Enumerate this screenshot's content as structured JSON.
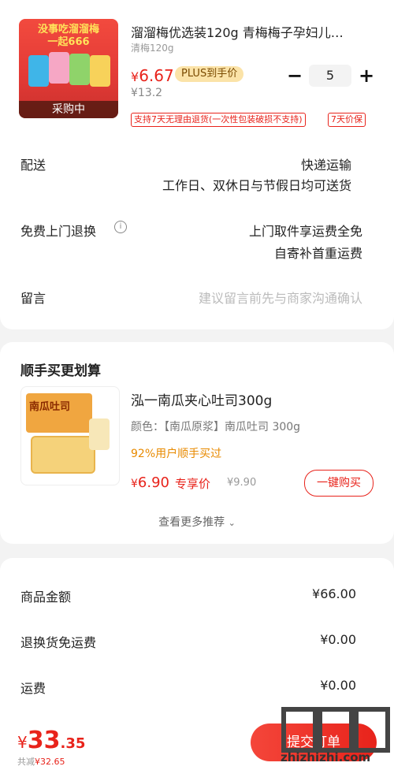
{
  "product": {
    "image": {
      "banner": "没事吃溜溜梅\n一起666",
      "status": "采购中"
    },
    "title": "溜溜梅优选装120g 青梅梅子孕妇儿…",
    "spec": "清梅120g",
    "price_symbol": "¥",
    "price": "6.67",
    "plus_badge": "PLUS到手价",
    "original_price": "¥13.2",
    "quantity": "5",
    "minus_icon": "minus-icon",
    "plus_icon": "plus-icon",
    "tags": [
      "支持7天无理由退货(一次性包装破损不支持)",
      "7天价保"
    ]
  },
  "rows": {
    "delivery_label": "配送",
    "delivery_method": "快递运输",
    "delivery_note": "工作日、双休日与节假日均可送货",
    "return_label": "免费上门退换",
    "return_line1": "上门取件享运费全免",
    "return_line2": "自寄补首重运费",
    "message_label": "留言",
    "message_placeholder": "建议留言前先与商家沟通确认"
  },
  "recommend": {
    "section_title": "顺手买更划算",
    "name": "泓一南瓜夹心吐司300g",
    "spec": "颜色：【南瓜原浆】南瓜吐司 300g",
    "social_proof": "92%用户顺手买过",
    "price_symbol": "¥",
    "price": "6.90",
    "exclusive_label": "专享价",
    "original_price": "¥9.90",
    "buy_button": "一键购买",
    "more_link": "查看更多推荐",
    "image_label": "南瓜吐司"
  },
  "summary": {
    "items": [
      {
        "label": "商品金额",
        "value": "¥66.00"
      },
      {
        "label": "退换货免运费",
        "value": "¥0.00"
      },
      {
        "label": "运费",
        "value": "¥0.00"
      }
    ]
  },
  "bottom": {
    "total_symbol": "¥",
    "total_int": "33",
    "total_dec": ".35",
    "saved_prefix": "共减",
    "saved_amount": "¥32.65",
    "submit_button": "提交订单",
    "watermark_text": "zhizhizhi.com"
  },
  "colors": {
    "accent": "#e8231b",
    "plus_badge_bg": "#fbe3a8",
    "social_orange": "#e88a00"
  }
}
